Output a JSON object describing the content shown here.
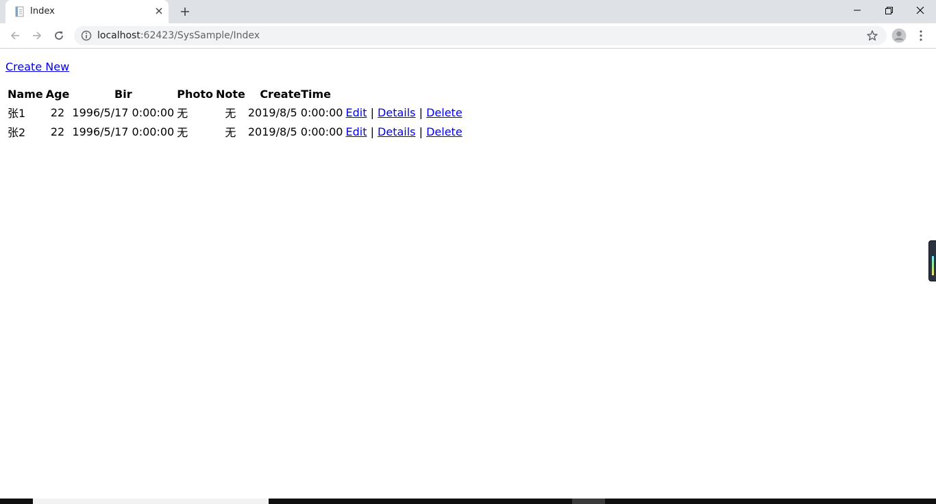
{
  "browser": {
    "tab_title": "Index",
    "url_host": "localhost",
    "url_rest": ":62423/SysSample/Index"
  },
  "page": {
    "create_link": "Create New",
    "headers": [
      "Name",
      "Age",
      "Bir",
      "Photo",
      "Note",
      "CreateTime"
    ],
    "rows": [
      {
        "name": "张1",
        "age": "22",
        "bir": "1996/5/17 0:00:00",
        "photo": "无",
        "note": "无",
        "create_time": "2019/8/5 0:00:00"
      },
      {
        "name": "张2",
        "age": "22",
        "bir": "1996/5/17 0:00:00",
        "photo": "无",
        "note": "无",
        "create_time": "2019/8/5 0:00:00"
      }
    ],
    "actions": {
      "edit": "Edit",
      "details": "Details",
      "delete": "Delete",
      "separator": "|"
    }
  },
  "icons": {
    "tab": "page-favicon",
    "close": "close-icon",
    "new_tab": "plus-icon",
    "back": "back-arrow-icon",
    "forward": "forward-arrow-icon",
    "reload": "reload-icon",
    "info": "info-icon",
    "bookmark": "star-icon",
    "profile": "avatar-icon",
    "menu": "kebab-menu-icon"
  },
  "colors": {
    "link": "#0000ee",
    "tabstrip": "#dee1e6",
    "omnibox": "#f1f3f4"
  }
}
